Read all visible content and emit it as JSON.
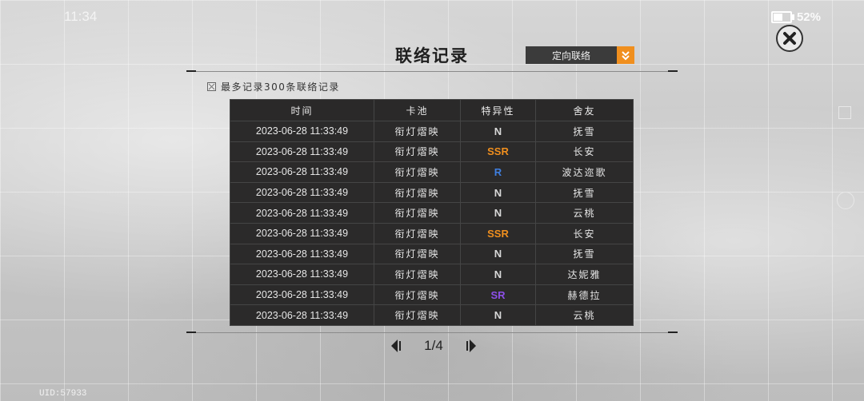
{
  "status_bar": {
    "time": "11:34",
    "battery_percent": "52%"
  },
  "panel": {
    "title": "联络记录",
    "dropdown_label": "定向联络",
    "note": "最多记录300条联络记录"
  },
  "table": {
    "headers": [
      "时间",
      "卡池",
      "特异性",
      "舍友"
    ],
    "rows": [
      {
        "time": "2023-06-28 11:33:49",
        "pool": "衔灯熠映",
        "rarity": "N",
        "friend": "抚雪"
      },
      {
        "time": "2023-06-28 11:33:49",
        "pool": "衔灯熠映",
        "rarity": "SSR",
        "friend": "长安"
      },
      {
        "time": "2023-06-28 11:33:49",
        "pool": "衔灯熠映",
        "rarity": "R",
        "friend": "波达迩歌"
      },
      {
        "time": "2023-06-28 11:33:49",
        "pool": "衔灯熠映",
        "rarity": "N",
        "friend": "抚雪"
      },
      {
        "time": "2023-06-28 11:33:49",
        "pool": "衔灯熠映",
        "rarity": "N",
        "friend": "云桃"
      },
      {
        "time": "2023-06-28 11:33:49",
        "pool": "衔灯熠映",
        "rarity": "SSR",
        "friend": "长安"
      },
      {
        "time": "2023-06-28 11:33:49",
        "pool": "衔灯熠映",
        "rarity": "N",
        "friend": "抚雪"
      },
      {
        "time": "2023-06-28 11:33:49",
        "pool": "衔灯熠映",
        "rarity": "N",
        "friend": "达妮雅"
      },
      {
        "time": "2023-06-28 11:33:49",
        "pool": "衔灯熠映",
        "rarity": "SR",
        "friend": "赫德拉"
      },
      {
        "time": "2023-06-28 11:33:49",
        "pool": "衔灯熠映",
        "rarity": "N",
        "friend": "云桃"
      }
    ]
  },
  "rarity_colors": {
    "N": "#d8d8d8",
    "R": "#3f7fe0",
    "SR": "#8d4fe8",
    "SSR": "#f08f1e"
  },
  "pagination": {
    "page": "1/4"
  },
  "footer": {
    "uid": "UID:57933"
  },
  "colors": {
    "accent": "#f08f1e",
    "table_bg": "#2b2a2a"
  }
}
